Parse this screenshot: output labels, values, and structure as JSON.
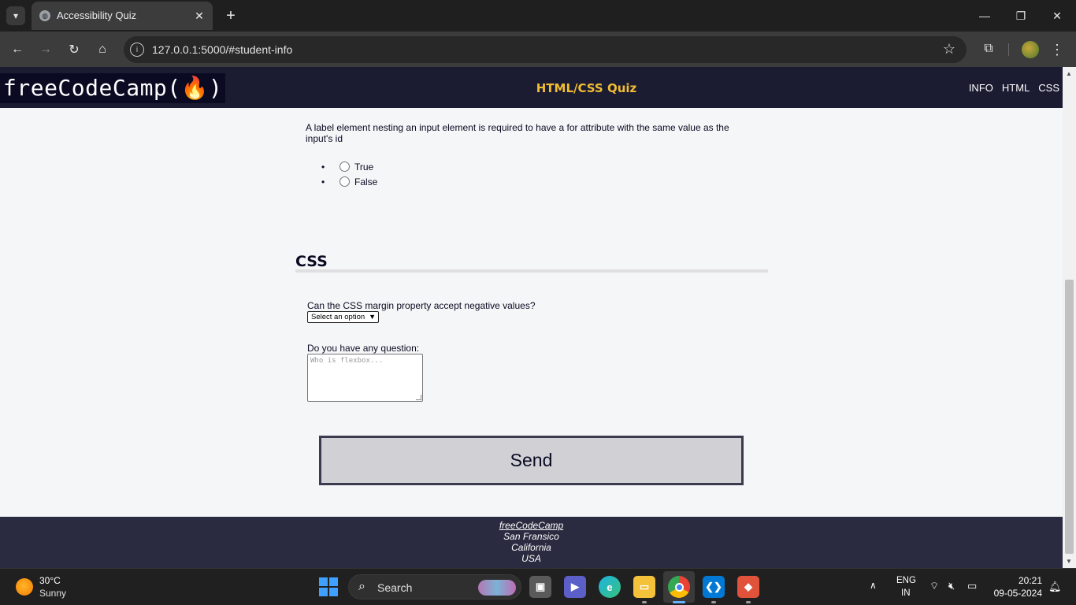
{
  "browser": {
    "tab_title": "Accessibility Quiz",
    "url": "127.0.0.1:5000/#student-info"
  },
  "site": {
    "logo": "freeCodeCamp(🔥)",
    "title": "HTML/CSS Quiz",
    "nav": [
      "INFO",
      "HTML",
      "CSS"
    ]
  },
  "html_section": {
    "question": "A label element nesting an input element is required to have a for attribute with the same value as the input's id",
    "options": [
      "True",
      "False"
    ]
  },
  "css_section": {
    "heading": "CSS",
    "question": "Can the CSS margin property accept negative values?",
    "select_value": "Select an option",
    "textarea_label": "Do you have any question:",
    "textarea_placeholder": "Who is flexbox..."
  },
  "send_label": "Send",
  "footer": {
    "lines": [
      "freeCodeCamp",
      "San Fransico",
      "California",
      "USA"
    ]
  },
  "taskbar": {
    "temperature": "30°C",
    "condition": "Sunny",
    "search_label": "Search",
    "lang_top": "ENG",
    "lang_bottom": "IN",
    "time": "20:21",
    "date": "09-05-2024"
  },
  "colors": {
    "header_bg": "#1b1b32",
    "title_yellow": "#f1be32",
    "footer_bg": "#2a2a40",
    "button_bg": "#d0d0d5"
  }
}
